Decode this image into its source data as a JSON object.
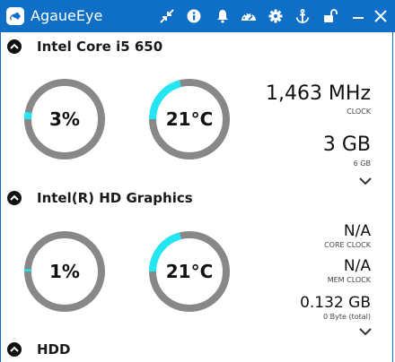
{
  "app": {
    "title": "AgaueEye"
  },
  "titlebar_icons": [
    "minimize-arrows-icon",
    "info-icon",
    "bell-icon",
    "dashboard-icon",
    "gear-icon",
    "anchor-icon",
    "unlock-icon",
    "minimize-icon",
    "close-icon"
  ],
  "colors": {
    "accent": "#0f6fc6",
    "gauge_track": "#888888",
    "gauge_fill": "#22e6f2"
  },
  "cpu": {
    "title": "Intel Core i5 650",
    "load": {
      "label": "3%",
      "value": 0.03
    },
    "temp": {
      "label": "21°C",
      "value": 0.21
    },
    "clock": {
      "value": "1,463 MHz",
      "label": "CLOCK"
    },
    "memory": {
      "value": "3 GB",
      "label": "6 GB"
    }
  },
  "gpu": {
    "title": "Intel(R) HD Graphics",
    "load": {
      "label": "1%",
      "value": 0.01
    },
    "temp": {
      "label": "21°C",
      "value": 0.21
    },
    "core_clock": {
      "value": "N/A",
      "label": "CORE CLOCK"
    },
    "mem_clock": {
      "value": "N/A",
      "label": "MEM CLOCK"
    },
    "memory": {
      "value": "0.132 GB",
      "label": "0 Byte (total)"
    }
  },
  "hdd": {
    "title": "HDD"
  }
}
